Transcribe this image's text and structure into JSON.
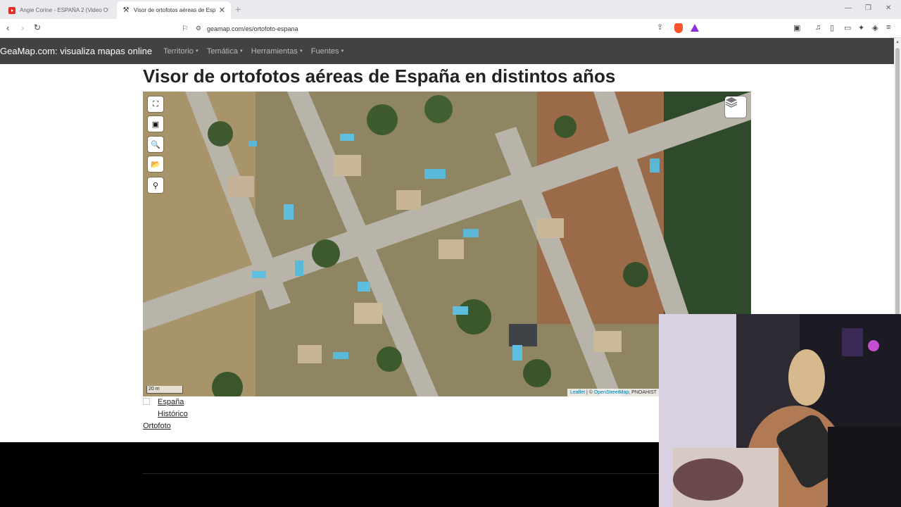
{
  "browser": {
    "tabs": [
      {
        "title": "Angie Corine - ESPAÑA 2 (Video Ofi",
        "favicon": "youtube-icon",
        "active": false
      },
      {
        "title": "Visor de ortofotos aéreas de Esp",
        "favicon": "geamap-icon",
        "active": true
      }
    ],
    "url": "geamap.com/es/ortofoto-espana"
  },
  "site": {
    "brand": "GeaMap.com: visualiza mapas online",
    "nav": [
      "Territorio",
      "Temática",
      "Herramientas",
      "Fuentes"
    ]
  },
  "page": {
    "title": "Visor de ortofotos aéreas de España en distintos años"
  },
  "map": {
    "scale_label": "20 m",
    "attribution": {
      "leaflet": "Leaflet",
      "sep": " | © ",
      "osm": "OpenStreetMap",
      "rest": ", PNOAHIST"
    },
    "controls": [
      "fullscreen-icon",
      "print-icon",
      "search-icon",
      "open-folder-icon",
      "location-pin-icon"
    ],
    "layers_icon": "layers-icon"
  },
  "links": [
    "España",
    "Histórico",
    "Ortofoto"
  ],
  "colors": {
    "navbar": "#424242",
    "footer": "#000000",
    "link_blue": "#0078a8"
  }
}
